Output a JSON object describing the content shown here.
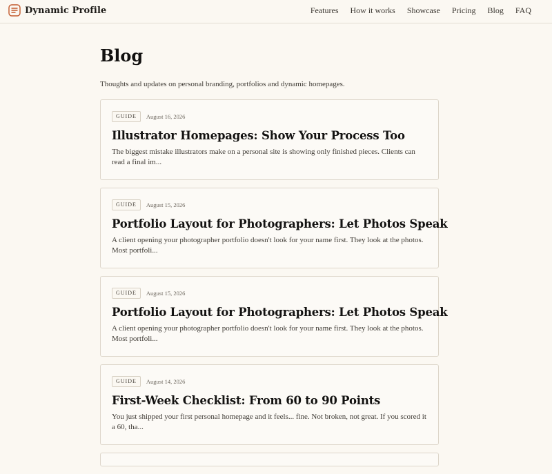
{
  "brand": {
    "name": "Dynamic Profile",
    "icon": "menu-lines-icon",
    "accent": "#c2582b"
  },
  "nav": {
    "items": [
      "Features",
      "How it works",
      "Showcase",
      "Pricing",
      "Blog",
      "FAQ"
    ]
  },
  "page": {
    "title": "Blog",
    "subtitle": "Thoughts and updates on personal branding, portfolios and dynamic homepages."
  },
  "posts": [
    {
      "tag": "GUIDE",
      "date": "August 16, 2026",
      "title": "Illustrator Homepages: Show Your Process Too",
      "excerpt": "The biggest mistake illustrators make on a personal site is showing only finished pieces. Clients can read a final im..."
    },
    {
      "tag": "GUIDE",
      "date": "August 15, 2026",
      "title": "Portfolio Layout for Photographers: Let Photos Speak",
      "excerpt": "A client opening your photographer portfolio doesn't look for your name first. They look at the photos. Most portfoli..."
    },
    {
      "tag": "GUIDE",
      "date": "August 15, 2026",
      "title": "Portfolio Layout for Photographers: Let Photos Speak",
      "excerpt": "A client opening your photographer portfolio doesn't look for your name first. They look at the photos. Most portfoli..."
    },
    {
      "tag": "GUIDE",
      "date": "August 14, 2026",
      "title": "First-Week Checklist: From 60 to 90 Points",
      "excerpt": "You just shipped your first personal homepage and it feels... fine. Not broken, not great. If you scored it a 60, tha..."
    }
  ]
}
